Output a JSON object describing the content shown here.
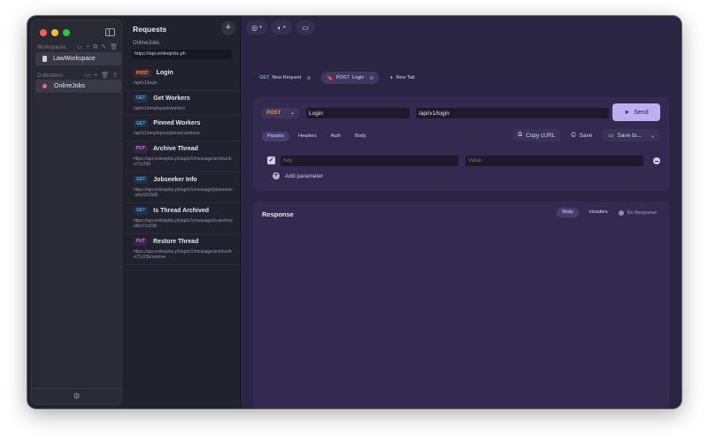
{
  "sidebar": {
    "workspaces_label": "Workspaces",
    "workspace_item": "LawWorkspace",
    "collections_label": "Collections",
    "collection_item": "OnlineJobs"
  },
  "requests": {
    "title": "Requests",
    "add_label": "+",
    "collection_name": "OnlineJobs",
    "collection_url": "https://api.onlinejobs.ph",
    "items": [
      {
        "method": "POST",
        "name": "Login",
        "path": "/api/v1/login"
      },
      {
        "method": "GET",
        "name": "Get Workers",
        "path": "/api/v1/employers/workers"
      },
      {
        "method": "GET",
        "name": "Pinned Workers",
        "path": "/api/v1/employers/pinned-workers"
      },
      {
        "method": "PUT",
        "name": "Archive Thread",
        "path": "https://api.onlinejobs.ph/api/v1/message/archive/bo71z23b"
      },
      {
        "method": "GET",
        "name": "Jobseeker Info",
        "path": "https://api.onlinejobs.ph/api/v1/message/jobseeker-info/331595"
      },
      {
        "method": "GET",
        "name": "Is Thread Archived",
        "path": "https://api.onlinejobs.ph/api/v1/message/is-archived/bo71z23b"
      },
      {
        "method": "PUT",
        "name": "Restore Thread",
        "path": "https://api.onlinejobs.ph/api/v1/message/archive/bo71z23b/restore"
      }
    ]
  },
  "tabs": [
    {
      "method": "GET",
      "label": "New Request"
    },
    {
      "method": "POST",
      "label": "Login"
    }
  ],
  "new_tab_label": "New Tab",
  "request": {
    "method": "POST",
    "name": "Login",
    "url": "/api/v1/login",
    "send_label": "Send",
    "sub_tabs": [
      "Params",
      "Headers",
      "Auth",
      "Body"
    ],
    "copy_curl_label": "Copy cURL",
    "save_label": "Save",
    "save_to_label": "Save to...",
    "key_placeholder": "Key",
    "value_placeholder": "Value",
    "add_param_label": "Add parameter"
  },
  "response": {
    "title": "Response",
    "tabs": [
      "Body",
      "Headers"
    ],
    "status": "No Response"
  },
  "colors": {
    "post": "#f0915f",
    "get": "#5aa7ef",
    "put": "#c37be8",
    "accent": "#bdb0f2"
  }
}
